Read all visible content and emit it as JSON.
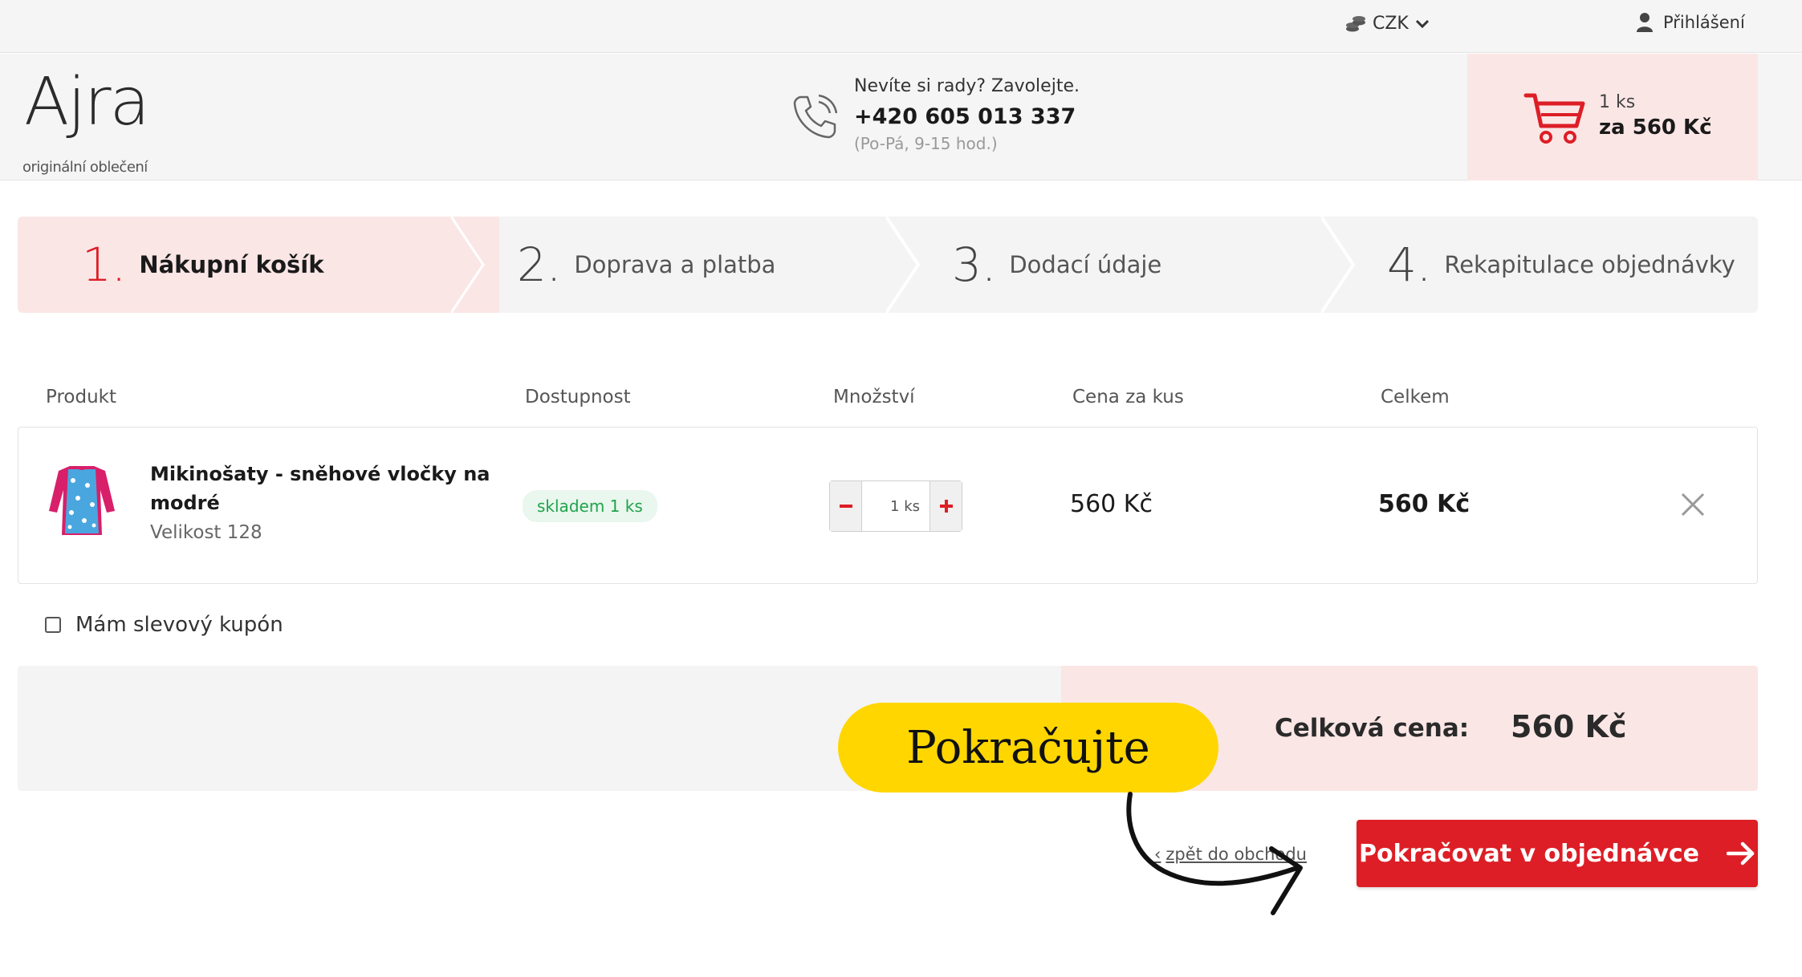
{
  "topbar": {
    "currency": "CZK",
    "login": "Přihlášení"
  },
  "header": {
    "logo_main": "Ajra",
    "logo_sub": "originální oblečení",
    "phone_question": "Nevíte si rady? Zavolejte.",
    "phone_number": "+420 605 013 337",
    "phone_hours": "(Po-Pá, 9-15 hod.)",
    "cart_count": "1 ks",
    "cart_total": "za 560 Kč"
  },
  "steps": [
    {
      "num": "1.",
      "label": "Nákupní košík"
    },
    {
      "num": "2.",
      "label": "Doprava a platba"
    },
    {
      "num": "3.",
      "label": "Dodací údaje"
    },
    {
      "num": "4.",
      "label": "Rekapitulace objednávky"
    }
  ],
  "table": {
    "headers": [
      "Produkt",
      "Dostupnost",
      "Množství",
      "Cena za kus",
      "Celkem"
    ],
    "rows": [
      {
        "name": "Mikinošaty - sněhové vločky na modré",
        "variant": "Velikost 128",
        "availability": "skladem 1 ks",
        "quantity": "1 ks",
        "unit_price": "560 Kč",
        "total": "560 Kč"
      }
    ]
  },
  "coupon_label": "Mám slevový kupón",
  "summary": {
    "label": "Celková cena:",
    "value": "560 Kč"
  },
  "actions": {
    "back": "zpět do obchodu",
    "continue": "Pokračovat v objednávce"
  },
  "annotation": {
    "text": "Pokračujte"
  },
  "colors": {
    "accent": "#dd1e26",
    "pink_bg": "#fbe6e6",
    "stock_green": "#1fa34a",
    "highlight": "#ffd600"
  }
}
